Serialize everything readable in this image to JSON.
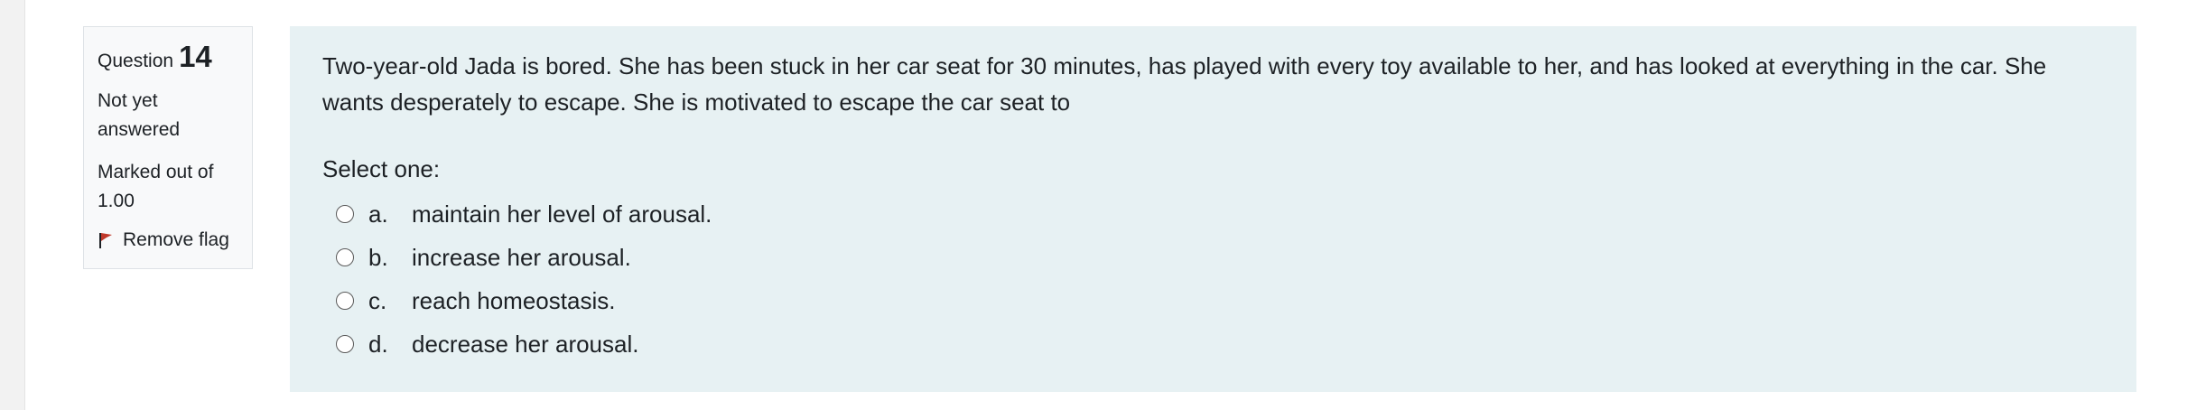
{
  "info": {
    "question_label": "Question",
    "question_number": "14",
    "state": "Not yet answered",
    "grade": "Marked out of 1.00",
    "flag_label": "Remove flag"
  },
  "question": {
    "text": "Two-year-old Jada is bored. She has been stuck in her car seat for 30 minutes, has played with every toy available to her, and has looked at everything in the car. She wants desperately to escape. She is motivated to escape the car seat to",
    "prompt": "Select one:",
    "answers": [
      {
        "letter": "a.",
        "text": "maintain her level of arousal."
      },
      {
        "letter": "b.",
        "text": "increase her arousal."
      },
      {
        "letter": "c.",
        "text": "reach homeostasis."
      },
      {
        "letter": "d.",
        "text": "decrease her arousal."
      }
    ]
  },
  "colors": {
    "content_background": "#e7f1f3",
    "info_background": "#f8f9fa",
    "flag": "#c0392b"
  }
}
